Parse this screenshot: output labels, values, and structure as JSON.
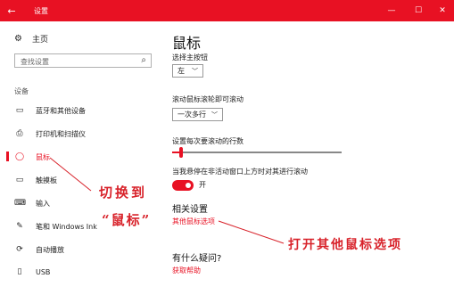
{
  "window": {
    "title": "设置",
    "back_glyph": "←",
    "minimize_glyph": "—",
    "maximize_glyph": "☐",
    "close_glyph": "✕",
    "accent": "#e81123"
  },
  "sidebar": {
    "home_label": "主页",
    "home_icon": "gear-icon",
    "search_placeholder": "查找设置",
    "group_label": "设备",
    "items": [
      {
        "label": "蓝牙和其他设备",
        "icon": "bluetooth-devices-icon",
        "glyph": "▭"
      },
      {
        "label": "打印机和扫描仪",
        "icon": "printer-icon",
        "glyph": "⎙"
      },
      {
        "label": "鼠标",
        "icon": "mouse-icon",
        "glyph": "◯"
      },
      {
        "label": "触摸板",
        "icon": "touchpad-icon",
        "glyph": "▭"
      },
      {
        "label": "输入",
        "icon": "keyboard-icon",
        "glyph": "⌨"
      },
      {
        "label": "笔和 Windows Ink",
        "icon": "pen-icon",
        "glyph": "✎"
      },
      {
        "label": "自动播放",
        "icon": "autoplay-icon",
        "glyph": "⟳"
      },
      {
        "label": "USB",
        "icon": "usb-icon",
        "glyph": "▯"
      }
    ],
    "active_index": 2
  },
  "main": {
    "title": "鼠标",
    "primary_button": {
      "label": "选择主按钮",
      "value": "左"
    },
    "scroll_mode": {
      "label": "滚动鼠标滚轮即可滚动",
      "value": "一次多行"
    },
    "lines_to_scroll": {
      "label": "设置每次要滚动的行数",
      "value_fraction": 0.05
    },
    "inactive_scroll": {
      "label": "当我悬停在非活动窗口上方时对其进行滚动",
      "state": "开",
      "on": true
    },
    "related": {
      "heading": "相关设置",
      "link": "其他鼠标选项"
    },
    "help": {
      "heading": "有什么疑问?",
      "link": "获取帮助"
    }
  },
  "annotations": {
    "switch_line1": "切换到",
    "switch_line2": "“鼠标”",
    "open_other": "打开其他鼠标选项",
    "color": "#d8222a"
  }
}
